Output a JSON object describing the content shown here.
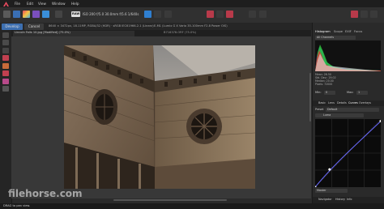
{
  "menu": [
    "File",
    "Edit",
    "View",
    "Window",
    "Help"
  ],
  "toolbar": {
    "raw_badge": "RAW",
    "camera_info": "ISO 200 f/5.0 30.0mm f/5.6 1/640s"
  },
  "persona_tabs": [
    "Develop",
    "Cancel"
  ],
  "info_line": {
    "size": "8640 × 3472px, 18.11MP, RGBA/32 (HDR) · sRGB IEC61966-2.1 (Linear)",
    "lens": "E-M1 (Lumix G X Vario 35-100mm F2.8 Power OIS)"
  },
  "doc_tabs": [
    "Lincoln Falls 10.jpg [Modified] (75.0%)",
    "B716378.ORF (75.0%)"
  ],
  "panel_tabs_top": [
    "Histogram",
    "Scope",
    "EXIF",
    "Focus"
  ],
  "histogram": {
    "channel": "All Channels",
    "stats_left": [
      "Mean: 26.50",
      "Std. Dev.: 29.02",
      "Median: 20.00",
      "Pixels: 72000"
    ],
    "min_label": "Min:",
    "min_value": "0",
    "max_label": "Max:",
    "max_value": "1"
  },
  "panel_tabs_mid": [
    "Basic",
    "Lens",
    "Details",
    "Curves",
    "Overlays"
  ],
  "curves": {
    "preset_label": "Preset",
    "preset_value": "Default",
    "channel_value": "Luma"
  },
  "curve_points": [
    [
      0,
      0
    ],
    [
      0.22,
      0.26
    ],
    [
      1,
      0.97
    ]
  ],
  "curves_footer": "Master",
  "panel_tabs_bottom": [
    "Navigator",
    "History",
    "Info"
  ],
  "status_text": "DRAG to pan view.",
  "watermark": "filehorse.com"
}
